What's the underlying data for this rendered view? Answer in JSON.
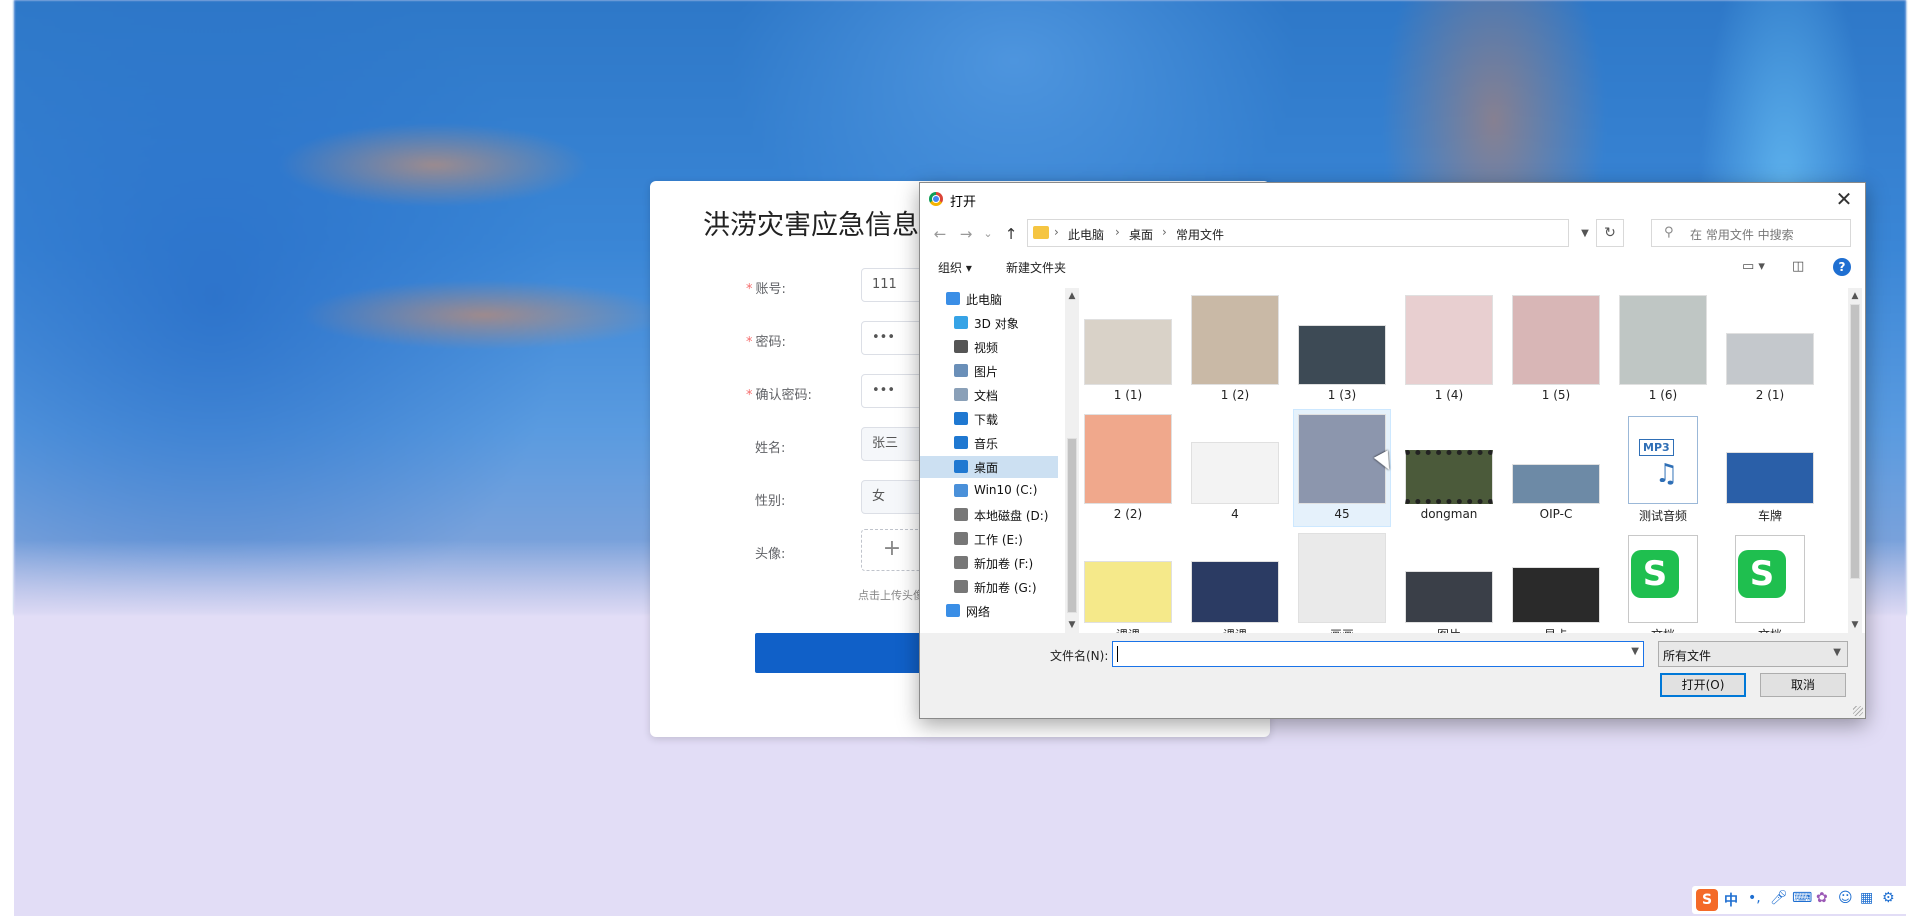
{
  "login": {
    "title": "洪涝灾害应急信息",
    "fields": [
      {
        "label": "账号:",
        "required": true,
        "value": "111"
      },
      {
        "label": "密码:",
        "required": true,
        "value": "•••"
      },
      {
        "label": "确认密码:",
        "required": true,
        "value": "•••"
      },
      {
        "label": "姓名:",
        "required": false,
        "value": "张三"
      },
      {
        "label": "性别:",
        "required": false,
        "value": "女"
      },
      {
        "label": "头像:",
        "required": false,
        "value": "+"
      }
    ],
    "avatar_hint": "点击上传头像",
    "required_mark": "*"
  },
  "dialog": {
    "title": "打开",
    "close": "✕",
    "nav": {
      "back": "←",
      "forward": "→",
      "recent": "⌄",
      "up": "↑"
    },
    "breadcrumb": [
      "此电脑",
      "桌面",
      "常用文件"
    ],
    "breadcrumb_sep": "›",
    "refresh": "↻",
    "search_placeholder": "在 常用文件 中搜索",
    "toolbar": {
      "organize": "组织 ▾",
      "new_folder": "新建文件夹",
      "help": "?"
    },
    "sidebar": [
      {
        "label": "此电脑",
        "icon": "computer-icon",
        "color": "#3a8ee6",
        "selected": false,
        "level": 0
      },
      {
        "label": "3D 对象",
        "icon": "3d-objects-icon",
        "color": "#36a3e6",
        "selected": false,
        "level": 1
      },
      {
        "label": "视频",
        "icon": "video-icon",
        "color": "#555555",
        "selected": false,
        "level": 1
      },
      {
        "label": "图片",
        "icon": "pictures-icon",
        "color": "#6a8fb8",
        "selected": false,
        "level": 1
      },
      {
        "label": "文档",
        "icon": "documents-icon",
        "color": "#8aa0b8",
        "selected": false,
        "level": 1
      },
      {
        "label": "下载",
        "icon": "downloads-icon",
        "color": "#1f78d1",
        "selected": false,
        "level": 1
      },
      {
        "label": "音乐",
        "icon": "music-icon",
        "color": "#1f78d1",
        "selected": false,
        "level": 1
      },
      {
        "label": "桌面",
        "icon": "desktop-icon",
        "color": "#1f78d1",
        "selected": true,
        "level": 1
      },
      {
        "label": "Win10 (C:)",
        "icon": "windows-drive-icon",
        "color": "#4a90d9",
        "selected": false,
        "level": 1
      },
      {
        "label": "本地磁盘 (D:)",
        "icon": "drive-icon",
        "color": "#777777",
        "selected": false,
        "level": 1
      },
      {
        "label": "工作 (E:)",
        "icon": "drive-icon",
        "color": "#777777",
        "selected": false,
        "level": 1
      },
      {
        "label": "新加卷 (F:)",
        "icon": "drive-icon",
        "color": "#777777",
        "selected": false,
        "level": 1
      },
      {
        "label": "新加卷 (G:)",
        "icon": "drive-icon",
        "color": "#777777",
        "selected": false,
        "level": 1
      },
      {
        "label": "网络",
        "icon": "network-icon",
        "color": "#3a8ee6",
        "selected": false,
        "level": 0
      }
    ],
    "files": [
      {
        "name": "1 (1)",
        "icon": "cat-photo",
        "bg": "#d9d2c8"
      },
      {
        "name": "1 (2)",
        "icon": "teaset-photo",
        "bg": "#c9b9a6"
      },
      {
        "name": "1 (3)",
        "icon": "house-photo",
        "bg": "#3d4a55"
      },
      {
        "name": "1 (4)",
        "icon": "baby-photo",
        "bg": "#e8cfd0"
      },
      {
        "name": "1 (5)",
        "icon": "baby-photo",
        "bg": "#d8b6b6"
      },
      {
        "name": "1 (6)",
        "icon": "baby-photo",
        "bg": "#bfc6c4"
      },
      {
        "name": "2 (1)",
        "icon": "car-photo",
        "bg": "#c4c8cc"
      },
      {
        "name": "2 (2)",
        "icon": "peach-photo",
        "bg": "#f0a88c"
      },
      {
        "name": "4",
        "icon": "document-thumb",
        "bg": "#f3f3f3"
      },
      {
        "name": "45",
        "icon": "girl-photo",
        "bg": "#8c96ad"
      },
      {
        "name": "dongman",
        "icon": "video-thumb",
        "bg": "#4b5a3a"
      },
      {
        "name": "OIP-C",
        "icon": "building-photo",
        "bg": "#6d8aa6"
      },
      {
        "name": "测试音频",
        "icon": "mp3-file-icon",
        "bg": "#ffffff"
      },
      {
        "name": "车牌",
        "icon": "car-photo",
        "bg": "#2a5fa8"
      },
      {
        "name": "课课",
        "icon": "cartoon-thumb",
        "bg": "#f5e98a"
      },
      {
        "name": "课课",
        "icon": "certificate-photo",
        "bg": "#2b3b63"
      },
      {
        "name": "画画",
        "icon": "deer-sketch",
        "bg": "#eaeaea"
      },
      {
        "name": "图片",
        "icon": "car-photo",
        "bg": "#3a3f48"
      },
      {
        "name": "显卡",
        "icon": "gpu-photo",
        "bg": "#2a2a2a"
      },
      {
        "name": "文档",
        "icon": "wps-doc-icon",
        "bg": "#ffffff"
      },
      {
        "name": "文档",
        "icon": "wps-doc-icon",
        "bg": "#ffffff"
      }
    ],
    "mp3_badge": "MP3",
    "wps_letter": "S",
    "filename_label": "文件名(N):",
    "filename_value": "",
    "filetype": "所有文件",
    "open_button": "打开(O)",
    "cancel_button": "取消"
  },
  "tray": {
    "ime": "中",
    "sogou": "S"
  },
  "colors": {
    "accent": "#0078d7",
    "submit": "#1060c8",
    "selected": "#cce0f2",
    "hover": "#e5f1fb"
  }
}
